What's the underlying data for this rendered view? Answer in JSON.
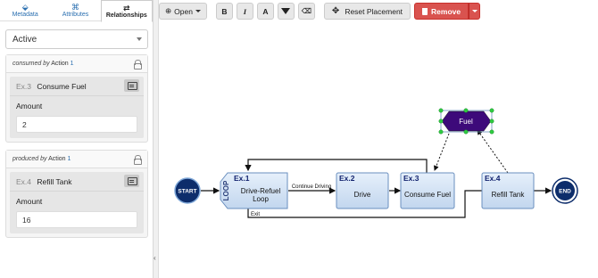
{
  "tabs": [
    {
      "label": "Metadata",
      "icon": "tag-icon"
    },
    {
      "label": "Attributes",
      "icon": "sitemap-icon"
    },
    {
      "label": "Relationships",
      "icon": "swap-arrows-icon"
    }
  ],
  "status_select": {
    "value": "Active"
  },
  "consumed": {
    "prefix": "consumed by",
    "suffix": "Action",
    "count": "1",
    "item": {
      "code": "Ex.3",
      "name": "Consume Fuel",
      "field_label": "Amount",
      "field_value": "2"
    }
  },
  "produced": {
    "prefix": "produced by",
    "suffix": "Action",
    "count": "1",
    "item": {
      "code": "Ex.4",
      "name": "Refill Tank",
      "field_label": "Amount",
      "field_value": "16"
    }
  },
  "toolbar": {
    "open_label": "Open",
    "bold": "B",
    "italic": "I",
    "font": "A",
    "reset_label": "Reset Placement",
    "remove_label": "Remove"
  },
  "diagram": {
    "start": "START",
    "end": "END",
    "fuel": "Fuel",
    "loop_tag": "LOOP",
    "loop": {
      "code": "Ex.1",
      "line1": "Drive-Refuel",
      "line2": "Loop"
    },
    "drive": {
      "code": "Ex.2",
      "name": "Drive"
    },
    "consume": {
      "code": "Ex.3",
      "name": "Consume Fuel"
    },
    "refill": {
      "code": "Ex.4",
      "name": "Refill Tank"
    },
    "edge_continue": "Continue Driving",
    "edge_exit": "Exit"
  },
  "colors": {
    "accent": "#2a6fb0",
    "navy": "#0d2d6b",
    "fuel": "#3d0a7a",
    "remove": "#d9534f"
  }
}
